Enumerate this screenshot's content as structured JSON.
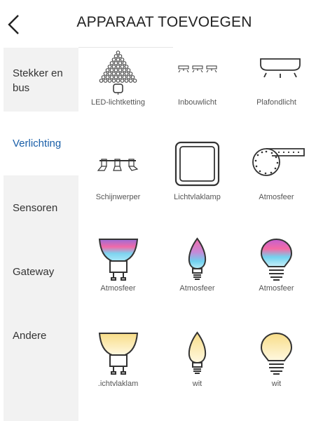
{
  "header": {
    "title": "APPARAAT TOEVOEGEN"
  },
  "sidebar": {
    "items": [
      {
        "label": "Stekker en bus",
        "active": false
      },
      {
        "label": "Verlichting",
        "active": true
      },
      {
        "label": "Sensoren",
        "active": false
      },
      {
        "label": "Gateway",
        "active": false
      },
      {
        "label": "Andere",
        "active": false
      }
    ]
  },
  "devices": [
    {
      "label": "LED-lichtketting",
      "icon": "led-string-icon"
    },
    {
      "label": "Inbouwlicht",
      "icon": "recessed-light-icon"
    },
    {
      "label": "Plafondlicht",
      "icon": "ceiling-light-icon"
    },
    {
      "label": "Schijnwerper",
      "icon": "spotlight-icon"
    },
    {
      "label": "Lichtvlaklamp",
      "icon": "light-panel-icon"
    },
    {
      "label": "Atmosfeer",
      "icon": "light-strip-icon"
    },
    {
      "label": "Atmosfeer",
      "icon": "gu10-color-bulb-icon"
    },
    {
      "label": "Atmosfeer",
      "icon": "candle-color-bulb-icon"
    },
    {
      "label": "Atmosfeer",
      "icon": "color-bulb-icon"
    },
    {
      "label": ".ichtvlaklam",
      "icon": "gu10-white-bulb-icon"
    },
    {
      "label": "wit",
      "icon": "candle-white-bulb-icon"
    },
    {
      "label": "wit",
      "icon": "white-bulb-icon"
    }
  ],
  "colors": {
    "accent": "#1a5fa8",
    "sidebar_bg": "#f2f2f2",
    "icon_stroke": "#333333",
    "warm_white": "#fbe9a8"
  }
}
